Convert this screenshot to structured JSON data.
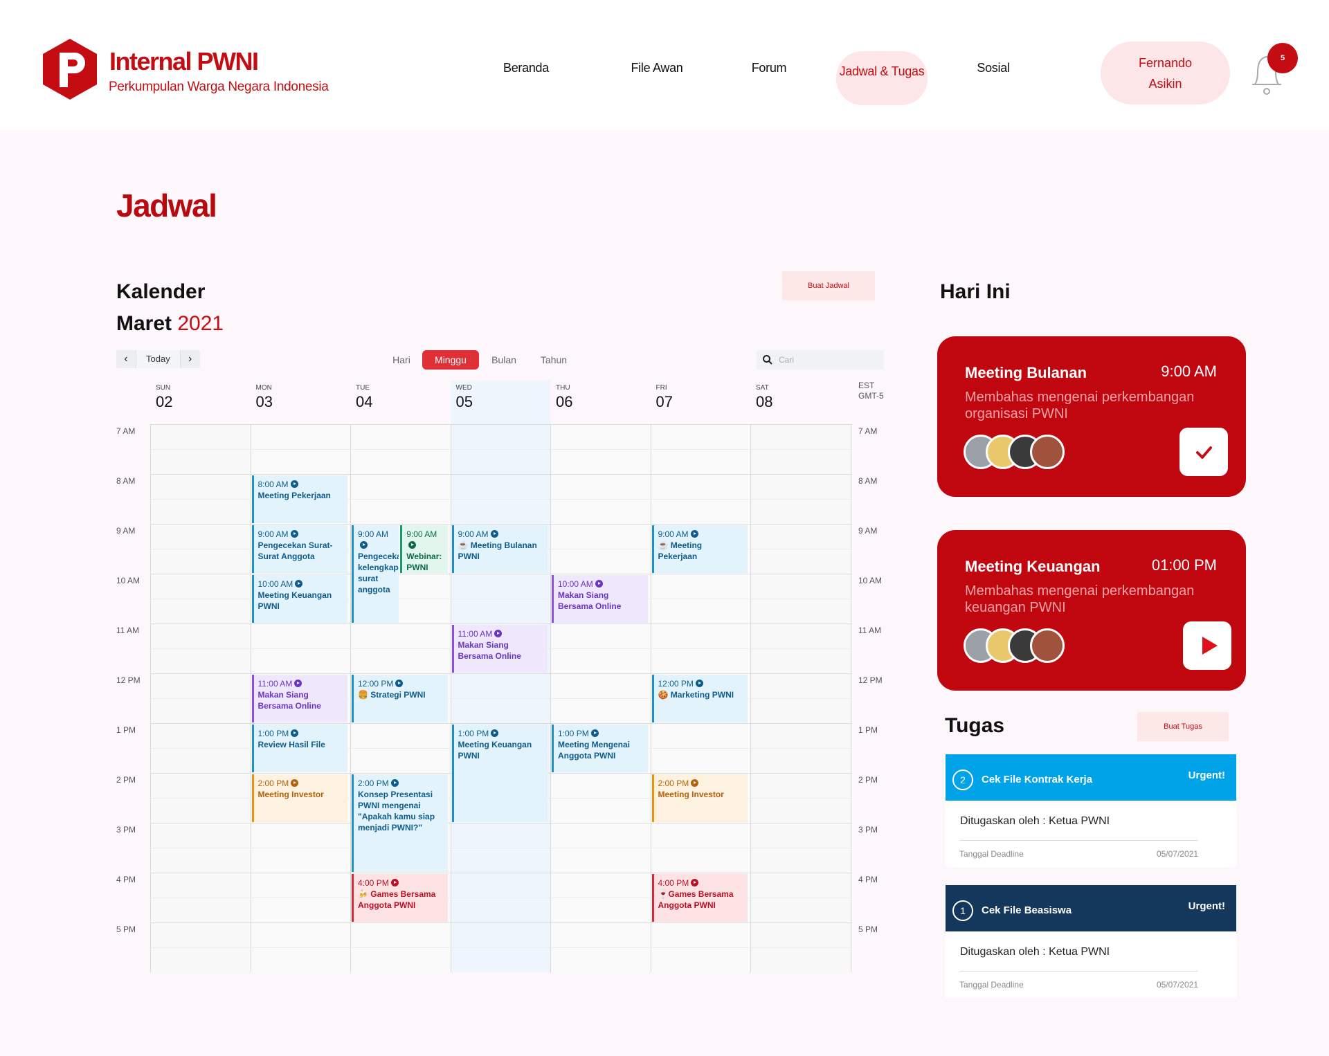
{
  "header": {
    "brand_name": "Internal PWNI",
    "brand_sub": "Perkumpulan Warga Negara Indonesia",
    "nav": [
      {
        "label": "Beranda"
      },
      {
        "label": "File Awan"
      },
      {
        "label": "Forum"
      },
      {
        "label": "Jadwal & Tugas",
        "active": true
      },
      {
        "label": "Sosial"
      }
    ],
    "user_first": "Fernando",
    "user_last": "Asikin",
    "notif_count": "5",
    "brand_color": "#c40d12"
  },
  "page": {
    "title": "Jadwal",
    "section": "Kalender",
    "month": "Maret",
    "year": "2021",
    "create_schedule": "Buat Jadwal"
  },
  "toolbar": {
    "today": "Today",
    "views": [
      "Hari",
      "Minggu",
      "Bulan",
      "Tahun"
    ],
    "active_view": "Minggu",
    "search_placeholder": "Cari"
  },
  "calendar": {
    "timezone": [
      "EST",
      "GMT-5"
    ],
    "days": [
      {
        "dow": "SUN",
        "date": "02"
      },
      {
        "dow": "MON",
        "date": "03"
      },
      {
        "dow": "TUE",
        "date": "04"
      },
      {
        "dow": "WED",
        "date": "05"
      },
      {
        "dow": "THU",
        "date": "06"
      },
      {
        "dow": "FRI",
        "date": "07"
      },
      {
        "dow": "SAT",
        "date": "08"
      }
    ],
    "highlighted_day": "WED",
    "hours": [
      "7 AM",
      "8 AM",
      "9 AM",
      "10 AM",
      "11 AM",
      "12 PM",
      "1 PM",
      "2 PM",
      "3 PM",
      "4 PM",
      "5 PM"
    ],
    "events": [
      {
        "day": 1,
        "start": 8.0,
        "end": 9.0,
        "time": "8:00 AM",
        "title": "Meeting Pekerjaan",
        "color": "blue"
      },
      {
        "day": 1,
        "start": 9.0,
        "end": 10.0,
        "time": "9:00 AM",
        "title": "Pengecekan Surat-Surat Anggota",
        "color": "blue"
      },
      {
        "day": 1,
        "start": 10.0,
        "end": 11.0,
        "time": "10:00 AM",
        "title": "Meeting Keuangan PWNI",
        "color": "blue"
      },
      {
        "day": 1,
        "start": 12.0,
        "end": 13.0,
        "time": "11:00 AM",
        "title": "Makan Siang Bersama Online",
        "color": "purple"
      },
      {
        "day": 1,
        "start": 13.0,
        "end": 14.0,
        "time": "1:00 PM",
        "title": "Review Hasil File",
        "color": "blue"
      },
      {
        "day": 1,
        "start": 14.0,
        "end": 15.0,
        "time": "2:00 PM",
        "title": "Meeting Investor",
        "color": "orange"
      },
      {
        "day": 2,
        "start": 9.0,
        "end": 11.0,
        "time": "9:00 AM",
        "title": "Pengecekan kelengkapan surat anggota",
        "color": "blue",
        "lane": 0,
        "lanes": 2
      },
      {
        "day": 2,
        "start": 9.0,
        "end": 10.0,
        "time": "9:00 AM",
        "title": "Webinar: PWNI",
        "color": "green",
        "lane": 1,
        "lanes": 2
      },
      {
        "day": 2,
        "start": 12.0,
        "end": 13.0,
        "time": "12:00 PM",
        "title": "🍔 Strategi PWNI",
        "color": "blue"
      },
      {
        "day": 2,
        "start": 14.0,
        "end": 16.0,
        "time": "2:00 PM",
        "title": "Konsep Presentasi PWNI mengenai \"Apakah kamu siap menjadi PWNI?\"",
        "color": "blue"
      },
      {
        "day": 2,
        "start": 16.0,
        "end": 17.0,
        "time": "4:00 PM",
        "title": "🍻 Games Bersama Anggota PWNI",
        "color": "red"
      },
      {
        "day": 3,
        "start": 9.0,
        "end": 10.0,
        "time": "9:00 AM",
        "title": "☕ Meeting Bulanan PWNI",
        "color": "blue"
      },
      {
        "day": 3,
        "start": 11.0,
        "end": 12.0,
        "time": "11:00 AM",
        "title": "Makan Siang Bersama Online",
        "color": "purple"
      },
      {
        "day": 3,
        "start": 13.0,
        "end": 15.0,
        "time": "1:00 PM",
        "title": "Meeting Keuangan PWNI",
        "color": "blue"
      },
      {
        "day": 4,
        "start": 10.0,
        "end": 11.0,
        "time": "10:00 AM",
        "title": "Makan Siang Bersama Online",
        "color": "purple"
      },
      {
        "day": 4,
        "start": 13.0,
        "end": 14.0,
        "time": "1:00 PM",
        "title": "Meeting Mengenai Anggota PWNI",
        "color": "blue"
      },
      {
        "day": 5,
        "start": 9.0,
        "end": 10.0,
        "time": "9:00 AM",
        "title": "☕ Meeting Pekerjaan",
        "color": "blue"
      },
      {
        "day": 5,
        "start": 12.0,
        "end": 13.0,
        "time": "12:00 PM",
        "title": "🍪 Marketing PWNI",
        "color": "blue"
      },
      {
        "day": 5,
        "start": 14.0,
        "end": 15.0,
        "time": "2:00 PM",
        "title": "Meeting Investor",
        "color": "orange"
      },
      {
        "day": 5,
        "start": 16.0,
        "end": 17.0,
        "time": "4:00 PM",
        "title": "🍷Games Bersama Anggota PWNI",
        "color": "red"
      }
    ]
  },
  "today": {
    "title": "Hari Ini",
    "meetings": [
      {
        "title": "Meeting Bulanan",
        "time": "9:00 AM",
        "desc": "Membahas mengenai perkembangan organisasi PWNI",
        "action": "check-icon"
      },
      {
        "title": "Meeting Keuangan",
        "time": "01:00 PM",
        "desc": "Membahas mengenai perkembangan keuangan PWNI",
        "action": "play-icon"
      }
    ]
  },
  "tasks": {
    "title": "Tugas",
    "create": "Buat Tugas",
    "items": [
      {
        "num": "2",
        "name": "Cek File Kontrak Kerja",
        "badge": "Urgent!",
        "assigned": "Ditugaskan oleh : Ketua PWNI",
        "deadline_label": "Tanggal Deadline",
        "deadline": "05/07/2021",
        "color": "#00a3e8"
      },
      {
        "num": "1",
        "name": "Cek File Beasiswa",
        "badge": "Urgent!",
        "assigned": "Ditugaskan oleh : Ketua PWNI",
        "deadline_label": "Tanggal Deadline",
        "deadline": "05/07/2021",
        "color": "#13385c"
      }
    ]
  }
}
